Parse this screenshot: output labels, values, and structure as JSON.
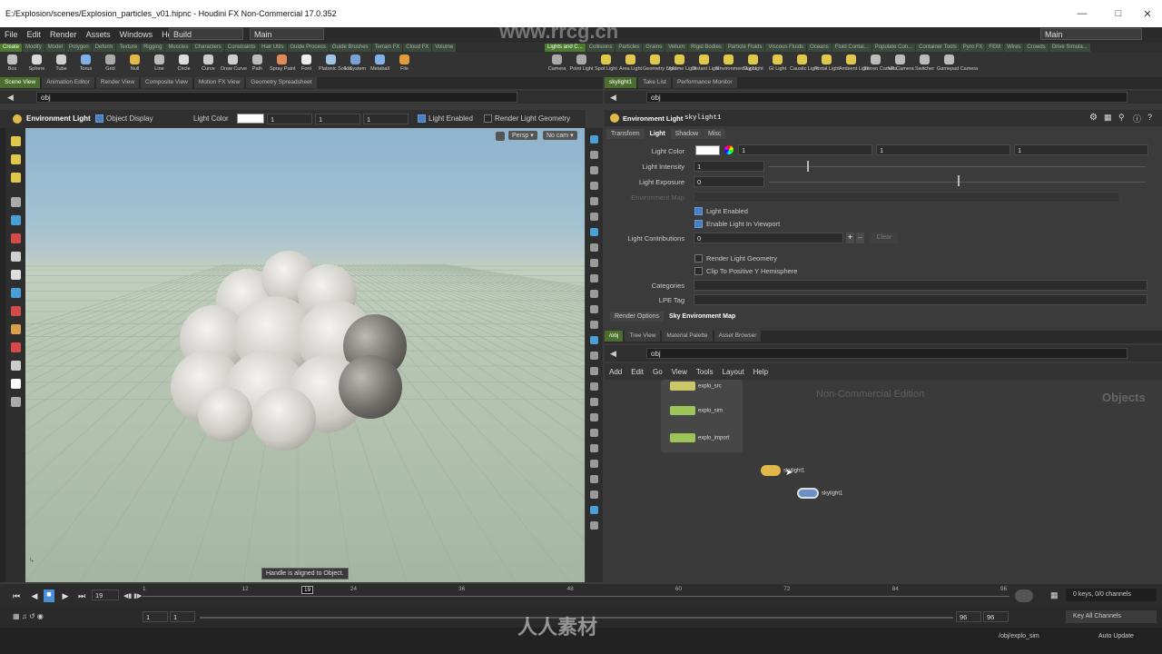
{
  "window": {
    "title": "E:/Explosion/scenes/Explosion_particles_v01.hipnc - Houdini FX Non-Commercial 17.0.352"
  },
  "menu": [
    "File",
    "Edit",
    "Render",
    "Assets",
    "Windows",
    "Help"
  ],
  "desktop": {
    "build": "Build",
    "left_main": "Main",
    "right_main": "Main"
  },
  "shelf_tabs_left": [
    "Create",
    "Modify",
    "Model",
    "Polygon",
    "Deform",
    "Texture",
    "Rigging",
    "Muscles",
    "Characters",
    "Constraints",
    "Hair Utils",
    "Guide Process",
    "Guide Brushes",
    "Terrain FX",
    "Cloud FX",
    "Volume"
  ],
  "shelf_tabs_right": [
    "Lights and C...",
    "Collisions",
    "Particles",
    "Grains",
    "Vellum",
    "Rigid Bodies",
    "Particle Fluids",
    "Viscous Fluids",
    "Oceans",
    "Fluid Contai...",
    "Populate Con...",
    "Container Tools",
    "Pyro FX",
    "FEM",
    "Wires",
    "Crowds",
    "Drive Simula..."
  ],
  "tools_left": [
    "Box",
    "Sphere",
    "Tube",
    "Torus",
    "Grid",
    "Null",
    "Line",
    "Circle",
    "Curve",
    "Draw Curve",
    "Path",
    "Spray Paint",
    "Font",
    "Platonic Solids",
    "L-System",
    "Metaball",
    "File"
  ],
  "tools_right": [
    "Camera",
    "Point Light",
    "Spot Light",
    "Area Light",
    "Geometry Light",
    "Volume Light",
    "Distant Light",
    "Environment Light",
    "Sky Light",
    "GI Light",
    "Caustic Light",
    "Portal Light",
    "Ambient Light",
    "Stereo Camera",
    "VR Camera",
    "Switcher",
    "Gamepad Camera"
  ],
  "left_pane_tabs": [
    "Scene View",
    "Animation Editor",
    "Render View",
    "Composite View",
    "Motion FX View",
    "Geometry Spreadsheet"
  ],
  "right_pane_tabs": [
    "skylight1",
    "Take List",
    "Performance Monitor"
  ],
  "net_tabs": [
    "/obj",
    "Tree View",
    "Material Palette",
    "Asset Browser"
  ],
  "path": "obj",
  "viewport": {
    "op_name": "Environment Light",
    "object_display": "Object Display",
    "light_color_label": "Light Color",
    "light_color_values": [
      "1",
      "1",
      "1"
    ],
    "light_enabled": "Light Enabled",
    "render_geo": "Render Light Geometry",
    "persp": "Persp",
    "cam": "No cam",
    "status": "Handle is aligned to Object."
  },
  "params": {
    "type": "Environment Light",
    "name": "skylight1",
    "tabs": [
      "Transform",
      "Light",
      "Shadow",
      "Misc"
    ],
    "light_color_label": "Light Color",
    "light_color": [
      "1",
      "1",
      "1"
    ],
    "intensity_label": "Light Intensity",
    "intensity": "1",
    "intensity_fraction": 0.1,
    "exposure_label": "Light Exposure",
    "exposure": "0",
    "exposure_fraction": 0.5,
    "env_map_label": "Environment Map",
    "light_enabled": "Light Enabled",
    "light_in_viewport": "Enable Light In Viewport",
    "contrib_label": "Light Contributions",
    "contrib": "0",
    "clear": "Clear",
    "render_geo": "Render Light Geometry",
    "clip": "Clip To Positive Y Hemisphere",
    "categories": "Categories",
    "lpe": "LPE Tag",
    "bottom_tabs": [
      "Render Options",
      "Sky Environment Map"
    ]
  },
  "network": {
    "menus": [
      "Add",
      "Edit",
      "Go",
      "View",
      "Tools",
      "Layout",
      "Help"
    ],
    "watermark": "Non-Commercial Edition",
    "context": "Objects",
    "nodes": [
      "explo_src",
      "explo_sim",
      "explo_import"
    ],
    "light_nodes": [
      "skylight1",
      "skylight1"
    ]
  },
  "timeline": {
    "frame": "19",
    "ticks": [
      "1",
      "12",
      "24",
      "36",
      "48",
      "60",
      "72",
      "84",
      "96"
    ],
    "start": "1",
    "start2": "1",
    "end": "96",
    "end2": "96",
    "keys": "0 keys, 0/0 channels",
    "key_all": "Key All Channels"
  },
  "status": {
    "path": "/obj/explo_sim",
    "auto_update": "Auto Update"
  },
  "colors": {
    "accent": "#4b6e2c",
    "node_yellow": "#e0b94a",
    "node_blue": "#6b8fc7"
  }
}
